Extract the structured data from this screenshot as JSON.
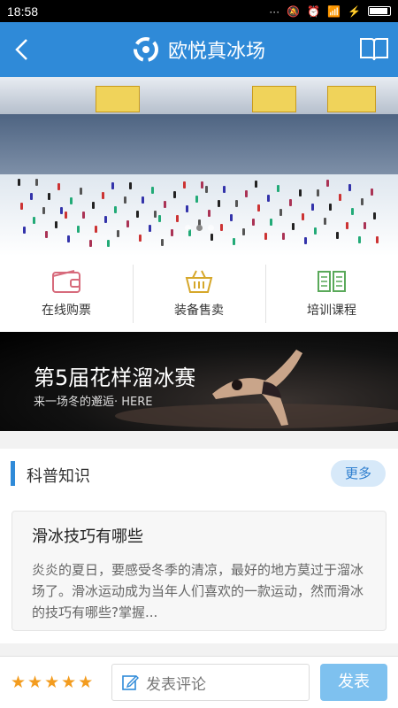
{
  "status_bar": {
    "time": "18:58"
  },
  "app_bar": {
    "title": "欧悦真冰场"
  },
  "hero": {
    "slide_count": 3,
    "active_slide": 1
  },
  "quick_menu": [
    {
      "label": "在线购票",
      "icon": "wallet-icon",
      "color": "#d76b7c"
    },
    {
      "label": "装备售卖",
      "icon": "basket-icon",
      "color": "#d6a72a"
    },
    {
      "label": "培训课程",
      "icon": "open-book-icon",
      "color": "#5aa95a"
    }
  ],
  "promo": {
    "title": "第5届花样溜冰赛",
    "subtitle": "来一场冬的邂逅· HERE"
  },
  "section": {
    "title": "科普知识",
    "more_label": "更多"
  },
  "article": {
    "title": "滑冰技巧有哪些",
    "body": "炎炎的夏日，要感受冬季的清凉，最好的地方莫过于溜冰场了。滑冰运动成为当年人们喜欢的一款运动，然而滑冰的技巧有哪些?掌握..."
  },
  "bottom_bar": {
    "rating": 5,
    "comment_placeholder": "发表评论",
    "submit_label": "发表"
  },
  "colors": {
    "primary": "#2f8ad8",
    "star": "#f39c1f",
    "submit": "#7ec1ef"
  }
}
